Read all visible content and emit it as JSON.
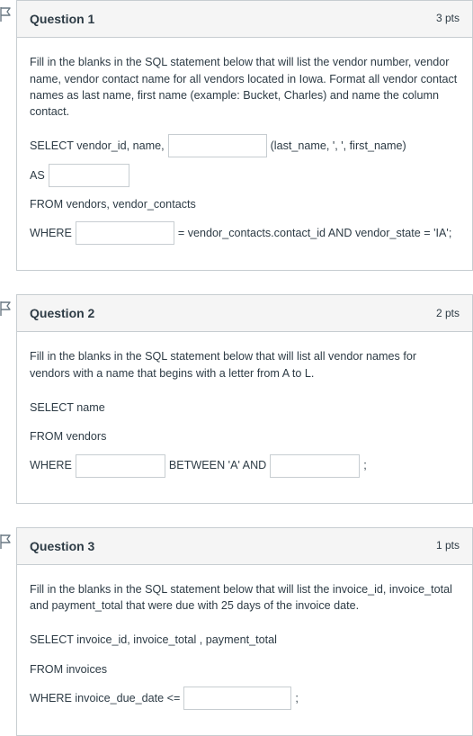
{
  "questions": [
    {
      "title": "Question 1",
      "pts": "3 pts",
      "instr": "Fill in the blanks in the SQL statement below that will list the vendor number, vendor name, vendor contact name for all vendors located in Iowa. Format all vendor contact names as last name, first name (example: Bucket, Charles) and name the column contact.",
      "sql": {
        "line1_pre": "SELECT vendor_id, name,",
        "line1_post": "(last_name, ', ', first_name)",
        "line2_pre": "AS",
        "line3": "FROM vendors, vendor_contacts",
        "line4_pre": "WHERE",
        "line4_post": "= vendor_contacts.contact_id AND vendor_state = 'IA';"
      }
    },
    {
      "title": "Question 2",
      "pts": "2 pts",
      "instr": "Fill in the blanks in the SQL statement below that will list all vendor names for vendors with a name that begins with a letter from A to L.",
      "sql": {
        "line1": "SELECT name",
        "line2": "FROM vendors",
        "line3_pre": "WHERE",
        "line3_mid": "BETWEEN 'A' AND",
        "line3_post": ";"
      }
    },
    {
      "title": "Question 3",
      "pts": "1 pts",
      "instr": "Fill in the blanks in the SQL statement below that will list the invoice_id, invoice_total and payment_total that were due with 25 days of the invoice date.",
      "sql": {
        "line1": "SELECT invoice_id, invoice_total , payment_total",
        "line2": "FROM invoices",
        "line3_pre": "WHERE invoice_due_date <=",
        "line3_post": ";"
      }
    }
  ]
}
